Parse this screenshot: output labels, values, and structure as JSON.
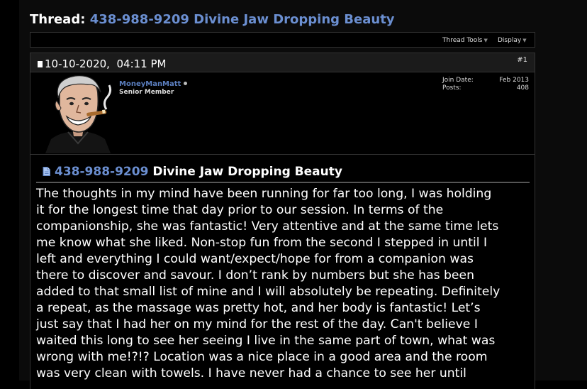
{
  "thread": {
    "prefix": "Thread:",
    "phone": "438-988-9209",
    "title": "Divine Jaw Dropping Beauty"
  },
  "toolbar": {
    "thread_tools_label": "Thread Tools",
    "display_label": "Display"
  },
  "post": {
    "date": "10-10-2020,",
    "time": "04:11 PM",
    "number": "#1",
    "user": {
      "name": "MoneyManMatt",
      "title": "Senior Member",
      "join_date_label": "Join Date:",
      "join_date_value": "Feb 2013",
      "posts_label": "Posts:",
      "posts_value": "408"
    },
    "title_phone": "438-988-9209",
    "title_text": "Divine Jaw Dropping Beauty",
    "body_lines": [
      "The thoughts in my mind have been running for far too long, I was holding",
      "it for the longest time that day prior to our session. In terms of the",
      "companionship, she was fantastic! Very attentive and at the same time lets",
      "me know what she liked. Non-stop fun from the second I stepped in until I",
      "left and everything I could want/expect/hope for from a companion was",
      "there to discover and savour. I don’t rank by numbers but she has been",
      "added to that small list of mine and I will absolutely be repeating. Definitely",
      "a repeat, as the massage was pretty hot, and her body is fantastic! Let’s",
      "just say that I had her on my mind for the rest of the day. Can't believe I",
      "waited this long to see her seeing I live in the same part of town, what was",
      "wrong with me!?!? Location was a nice place in a good area and the room",
      "was very clean with towels. I have never had a chance to see her until"
    ]
  },
  "icons": {
    "toolbar_caret": "chevron-down-icon",
    "post_bullet": "post-status-icon",
    "online_status": "online-status-icon",
    "post_title": "document-icon",
    "avatar": "cartoon-avatar-with-cigar"
  },
  "colors": {
    "link_blue": "#6b8fd1",
    "username_blue": "#5b7fc0",
    "background": "#000000",
    "header_bar": "#1b1b1b"
  }
}
